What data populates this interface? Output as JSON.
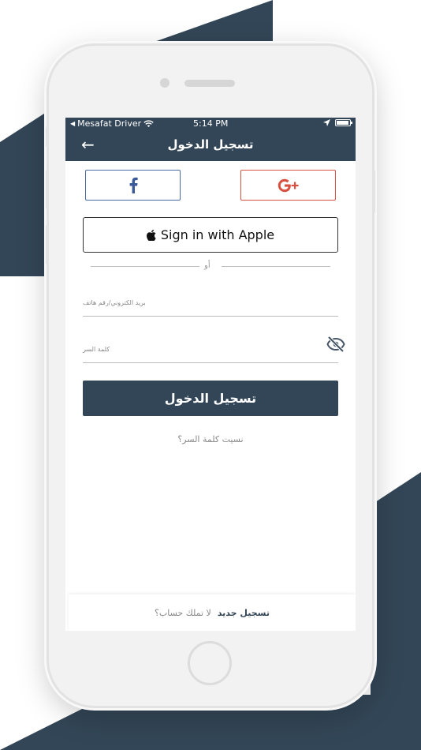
{
  "colors": {
    "primary": "#334657",
    "facebook": "#3b5998",
    "google": "#d95040"
  },
  "status_bar": {
    "carrier": "Mesafat Driver",
    "time": "5:14 PM"
  },
  "app_bar": {
    "back_icon": "arrow-left-icon",
    "title": "تسجيل الدخول"
  },
  "social": {
    "facebook_icon": "facebook-icon",
    "google_icon": "google-plus-icon",
    "apple_label": "Sign in with Apple"
  },
  "divider": {
    "text": "أو"
  },
  "form": {
    "email_placeholder": "بريد الكتروني/رقم هاتف",
    "password_placeholder": "كلمة السر",
    "password_toggle_icon": "eye-off-icon",
    "login_label": "تسجيل الدخول",
    "forgot_label": "نسيت كلمة السر؟"
  },
  "footer": {
    "question": "لا تملك حساب؟",
    "register_label": "تسجيل جديد"
  }
}
